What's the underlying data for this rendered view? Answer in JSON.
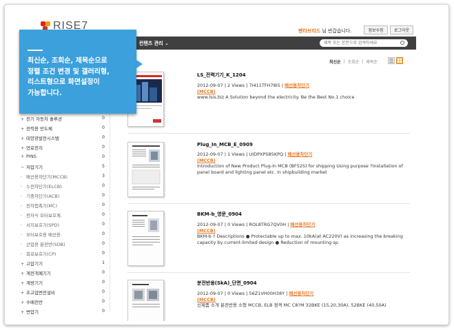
{
  "brand": {
    "name": "RISE7"
  },
  "header": {
    "greeting_user": "팬타브리드",
    "greeting_suffix": " 님 반갑습니다.",
    "profile_button": "정보수정",
    "logout_button": "로그아웃"
  },
  "nav": {
    "content_menu": "컨텐츠 관리 ⌄",
    "search_placeholder": "제목 또는 본문으로 검색하세요"
  },
  "sort": {
    "options": [
      "최신순",
      "조회순",
      "제목순"
    ]
  },
  "callout": {
    "text": "최신순, 조회순, 제목순으로\n정렬 조건 변경 및 갤러리형,\n리스트형으로 화면설정이\n가능합니다."
  },
  "sidebar": {
    "items": [
      {
        "mark": "+",
        "label": "전기 자동차 솔루션",
        "count": "0"
      },
      {
        "mark": "+",
        "label": "전력용 반도체",
        "count": "0"
      },
      {
        "mark": "+",
        "label": "태양광발전시스템",
        "count": "0"
      },
      {
        "mark": "+",
        "label": "연료전지",
        "count": "0"
      },
      {
        "mark": "+",
        "label": "PINS",
        "count": "0"
      },
      {
        "mark": "−",
        "label": "저압기기",
        "count": "5"
      },
      {
        "mark": "·",
        "label": "배선용차단기(MCCB)",
        "count": "3"
      },
      {
        "mark": "·",
        "label": "누전차단기(ELCB)",
        "count": "0"
      },
      {
        "mark": "·",
        "label": "기중차단기(ACB)",
        "count": "0"
      },
      {
        "mark": "·",
        "label": "전자접촉기(MC)",
        "count": "0"
      },
      {
        "mark": "·",
        "label": "전자식 모터보호계.",
        "count": "0"
      },
      {
        "mark": "·",
        "label": "서지보호기(SPD)",
        "count": "0"
      },
      {
        "mark": "·",
        "label": "모터보호용 배선용.",
        "count": "0"
      },
      {
        "mark": "·",
        "label": "산업용 분전반(SDB)",
        "count": "0"
      },
      {
        "mark": "·",
        "label": "회로보호기(CP)",
        "count": "0"
      },
      {
        "mark": "+",
        "label": "고압기기",
        "count": "1"
      },
      {
        "mark": "+",
        "label": "계전개폐기기",
        "count": "0"
      },
      {
        "mark": "+",
        "label": "계량기기",
        "count": "0"
      },
      {
        "mark": "+",
        "label": "초고압변전설비",
        "count": "0"
      },
      {
        "mark": "+",
        "label": "수배전반",
        "count": "0"
      },
      {
        "mark": "+",
        "label": "변압기",
        "count": "0"
      }
    ]
  },
  "documents": [
    {
      "title": "LS_전력기기_K_1204",
      "date": "2012-09-07",
      "views": "2 Views",
      "code": "7I411TFH78I5",
      "category": "배선용차단기",
      "tag": "(MCCB)",
      "description": "www.lsis.biz A Solution beyond the electricity. Be the Best No.1 choice"
    },
    {
      "title": "Plug_In_MCB_E_0909",
      "date": "2012-09-07",
      "views": "1 Views",
      "code": "UIDPXPS85KPQ",
      "category": "배선용차단기",
      "tag": "(MCCB)",
      "description": "Introduction of New Product Plug-In MCB (BF52S) for shipping Using purpose ?Installation of panel board and lighting panel etc. in shipbuilding market"
    },
    {
      "title": "BKM-b_영문_0904",
      "date": "2012-09-07",
      "views": "0 Views",
      "code": "ROL8TRG7QV0H",
      "category": "배선용차단기",
      "tag": "(MCCB)",
      "description": "BKM-b ? Descriptions ● Protectable up to max. 10kA(at AC220V) as increasing the breaking capacity by current-limited design ● Reduction of mounting sp"
    },
    {
      "title": "분전반용(SkA)_단면_0904",
      "date": "2012-09-07",
      "views": "0 Views",
      "code": "56Z1VH00H38Y",
      "category": "배선용차단기",
      "tag": "(MCCB)",
      "description": "신제품 소개 분전반용 소형 MCCB, ELB 정격 MC C8?M 32BKE (15,20,30A), 52BKE (40,50A)"
    }
  ]
}
